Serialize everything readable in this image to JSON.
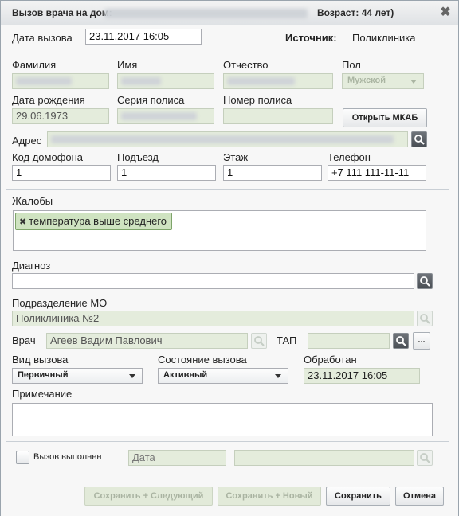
{
  "dialog": {
    "title_prefix": "Вызов врача на дом:",
    "title_age": "Возраст: 44 лет)",
    "close_glyph": "✖"
  },
  "call_date": {
    "label": "Дата вызова",
    "value": "23.11.2017 16:05"
  },
  "source": {
    "label": "Источник:",
    "value": "Поликлиника"
  },
  "patient": {
    "last_name_label": "Фамилия",
    "first_name_label": "Имя",
    "patronymic_label": "Отчество",
    "gender_label": "Пол",
    "gender_value": "Мужской",
    "birth_date_label": "Дата рождения",
    "birth_date_value": "29.06.1973",
    "policy_series_label": "Серия полиса",
    "policy_number_label": "Номер полиса",
    "open_mkab_button": "Открыть МКАБ"
  },
  "address": {
    "label": "Адрес"
  },
  "intercom": {
    "label": "Код домофона",
    "value": "1"
  },
  "entrance": {
    "label": "Подъезд",
    "value": "1"
  },
  "floor": {
    "label": "Этаж",
    "value": "1"
  },
  "phone": {
    "label": "Телефон",
    "value": "+7 111 111-11-11"
  },
  "complaints": {
    "label": "Жалобы",
    "tags": [
      "температура выше среднего"
    ]
  },
  "diagnosis": {
    "label": "Диагноз",
    "value": ""
  },
  "department": {
    "label": "Подразделение МО",
    "value": "Поликлиника №2"
  },
  "doctor": {
    "label": "Врач",
    "value": "Агеев Вадим Павлович"
  },
  "tap": {
    "label": "ТАП",
    "value": "",
    "more_button": "..."
  },
  "call_type": {
    "label": "Вид вызова",
    "value": "Первичный"
  },
  "call_state": {
    "label": "Состояние вызова",
    "value": "Активный"
  },
  "processed": {
    "label": "Обработан",
    "value": "23.11.2017 16:05"
  },
  "note": {
    "label": "Примечание",
    "value": ""
  },
  "completion": {
    "checkbox_label": "Вызов выполнен",
    "checked": false,
    "date_placeholder": "Дата"
  },
  "footer": {
    "save_next": "Сохранить + Следующий",
    "save_new": "Сохранить + Новый",
    "save": "Сохранить",
    "cancel": "Отмена"
  }
}
